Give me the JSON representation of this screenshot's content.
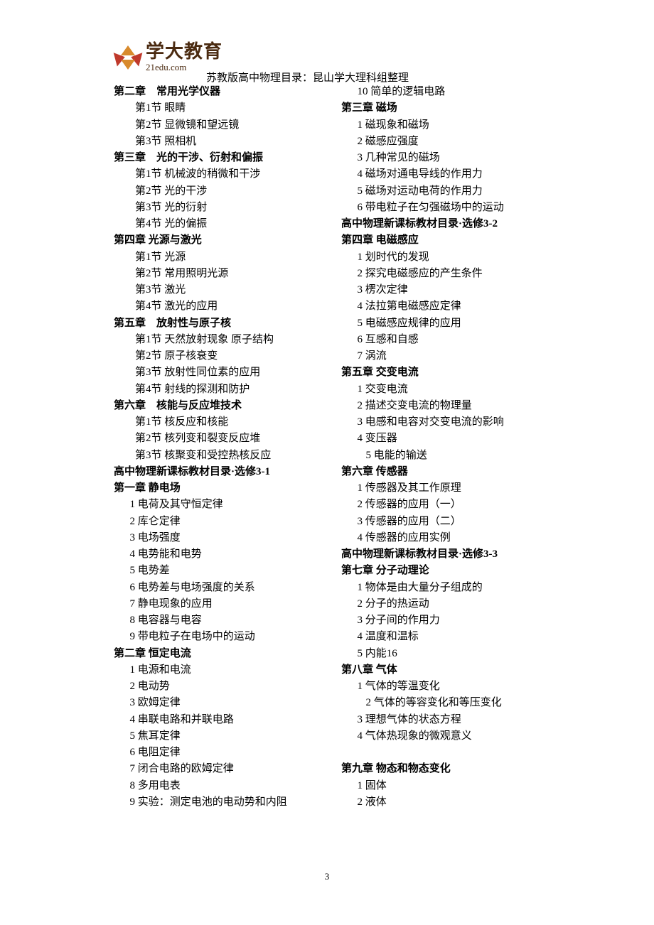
{
  "header": {
    "logo_cn": "学大教育",
    "logo_en": "21edu.com",
    "title": "苏教版高中物理目录：昆山学大理科组整理"
  },
  "page_number": "3",
  "left_column": [
    {
      "t": "chapter",
      "v": "第二章　常用光学仪器"
    },
    {
      "t": "section",
      "v": "第1节  眼睛"
    },
    {
      "t": "section",
      "v": "第2节  显微镜和望远镜"
    },
    {
      "t": "section",
      "v": "第3节  照相机"
    },
    {
      "t": "chapter",
      "v": "第三章　光的干涉、衍射和偏振"
    },
    {
      "t": "section",
      "v": "第1节  机械波的稍微和干涉"
    },
    {
      "t": "section",
      "v": "第2节  光的干涉"
    },
    {
      "t": "section",
      "v": "第3节  光的衍射"
    },
    {
      "t": "section",
      "v": "第4节  光的偏振"
    },
    {
      "t": "chapter",
      "v": "第四章  光源与激光"
    },
    {
      "t": "section",
      "v": "第1节  光源"
    },
    {
      "t": "section",
      "v": "第2节  常用照明光源"
    },
    {
      "t": "section",
      "v": "第3节  激光"
    },
    {
      "t": "section",
      "v": "第4节  激光的应用"
    },
    {
      "t": "chapter",
      "v": "第五章　放射性与原子核"
    },
    {
      "t": "section",
      "v": "第1节  天然放射现象  原子结构"
    },
    {
      "t": "section",
      "v": "第2节  原子核衰变"
    },
    {
      "t": "section",
      "v": "第3节  放射性同位素的应用"
    },
    {
      "t": "section",
      "v": "第4节  射线的探测和防护"
    },
    {
      "t": "chapter",
      "v": "第六章　核能与反应堆技术"
    },
    {
      "t": "section",
      "v": "第1节  核反应和核能"
    },
    {
      "t": "section",
      "v": "第2节  核列变和裂变反应堆"
    },
    {
      "t": "section",
      "v": "第3节  核聚变和受控热核反应"
    },
    {
      "t": "book-title",
      "v": "高中物理新课标教材目录·选修3-1"
    },
    {
      "t": "chapter",
      "v": "第一章  静电场"
    },
    {
      "t": "sub",
      "v": "1  电荷及其守恒定律"
    },
    {
      "t": "sub",
      "v": "2  库仑定律"
    },
    {
      "t": "sub",
      "v": "3  电场强度"
    },
    {
      "t": "sub",
      "v": "4  电势能和电势"
    },
    {
      "t": "sub",
      "v": "5  电势差"
    },
    {
      "t": "sub",
      "v": "6  电势差与电场强度的关系"
    },
    {
      "t": "sub",
      "v": "7  静电现象的应用"
    },
    {
      "t": "sub",
      "v": "8  电容器与电容"
    },
    {
      "t": "sub",
      "v": "9  带电粒子在电场中的运动"
    },
    {
      "t": "chapter",
      "v": "第二章  恒定电流"
    },
    {
      "t": "sub",
      "v": "1  电源和电流"
    },
    {
      "t": "sub",
      "v": "2  电动势"
    },
    {
      "t": "sub",
      "v": "3  欧姆定律"
    },
    {
      "t": "sub",
      "v": "4  串联电路和并联电路"
    },
    {
      "t": "sub",
      "v": "5  焦耳定律"
    },
    {
      "t": "sub",
      "v": "6  电阻定律"
    },
    {
      "t": "sub",
      "v": "7  闭合电路的欧姆定律"
    },
    {
      "t": "sub",
      "v": "8  多用电表"
    },
    {
      "t": "sub",
      "v": "9  实验：测定电池的电动势和内阻"
    }
  ],
  "right_column": [
    {
      "t": "sub",
      "v": "10  简单的逻辑电路"
    },
    {
      "t": "chapter",
      "v": "第三章  磁场"
    },
    {
      "t": "sub",
      "v": "1  磁现象和磁场"
    },
    {
      "t": "sub",
      "v": "2  磁感应强度"
    },
    {
      "t": "sub",
      "v": "3  几种常见的磁场"
    },
    {
      "t": "sub",
      "v": "4  磁场对通电导线的作用力"
    },
    {
      "t": "sub",
      "v": "5  磁场对运动电荷的作用力"
    },
    {
      "t": "sub",
      "v": "6  带电粒子在匀强磁场中的运动"
    },
    {
      "t": "book-title",
      "v": "高中物理新课标教材目录·选修3-2"
    },
    {
      "t": "chapter",
      "v": "第四章  电磁感应"
    },
    {
      "t": "sub",
      "v": "1  划时代的发现"
    },
    {
      "t": "sub",
      "v": "2  探究电磁感应的产生条件"
    },
    {
      "t": "sub",
      "v": "3  楞次定律"
    },
    {
      "t": "sub",
      "v": "4  法拉第电磁感应定律"
    },
    {
      "t": "sub",
      "v": "5  电磁感应规律的应用"
    },
    {
      "t": "sub",
      "v": "6  互感和自感"
    },
    {
      "t": "sub",
      "v": "7  涡流"
    },
    {
      "t": "chapter",
      "v": "第五章  交变电流"
    },
    {
      "t": "sub",
      "v": "1  交变电流"
    },
    {
      "t": "sub",
      "v": "2  描述交变电流的物理量"
    },
    {
      "t": "sub",
      "v": "3  电感和电容对交变电流的影响"
    },
    {
      "t": "sub",
      "v": "4  变压器"
    },
    {
      "t": "sub2",
      "v": "5  电能的输送"
    },
    {
      "t": "chapter",
      "v": "第六章  传感器"
    },
    {
      "t": "sub",
      "v": "1  传感器及其工作原理"
    },
    {
      "t": "sub",
      "v": "2  传感器的应用（一）"
    },
    {
      "t": "sub",
      "v": "3  传感器的应用（二）"
    },
    {
      "t": "sub",
      "v": "4  传感器的应用实例"
    },
    {
      "t": "book-title",
      "v": "高中物理新课标教材目录·选修3-3"
    },
    {
      "t": "chapter",
      "v": "第七章  分子动理论"
    },
    {
      "t": "sub",
      "v": "1  物体是由大量分子组成的"
    },
    {
      "t": "sub",
      "v": "2  分子的热运动"
    },
    {
      "t": "sub",
      "v": "3  分子间的作用力"
    },
    {
      "t": "sub",
      "v": "4  温度和温标"
    },
    {
      "t": "sub",
      "v": "5  内能16"
    },
    {
      "t": "chapter",
      "v": "第八章  气体"
    },
    {
      "t": "sub",
      "v": "1  气体的等温变化"
    },
    {
      "t": "sub2",
      "v": "2  气体的等容变化和等压变化"
    },
    {
      "t": "sub",
      "v": "3  理想气体的状态方程"
    },
    {
      "t": "sub",
      "v": "4  气体热现象的微观意义"
    },
    {
      "t": "blank",
      "v": ""
    },
    {
      "t": "chapter",
      "v": "第九章  物态和物态变化"
    },
    {
      "t": "sub",
      "v": "1  固体"
    },
    {
      "t": "sub",
      "v": "2  液体"
    }
  ]
}
